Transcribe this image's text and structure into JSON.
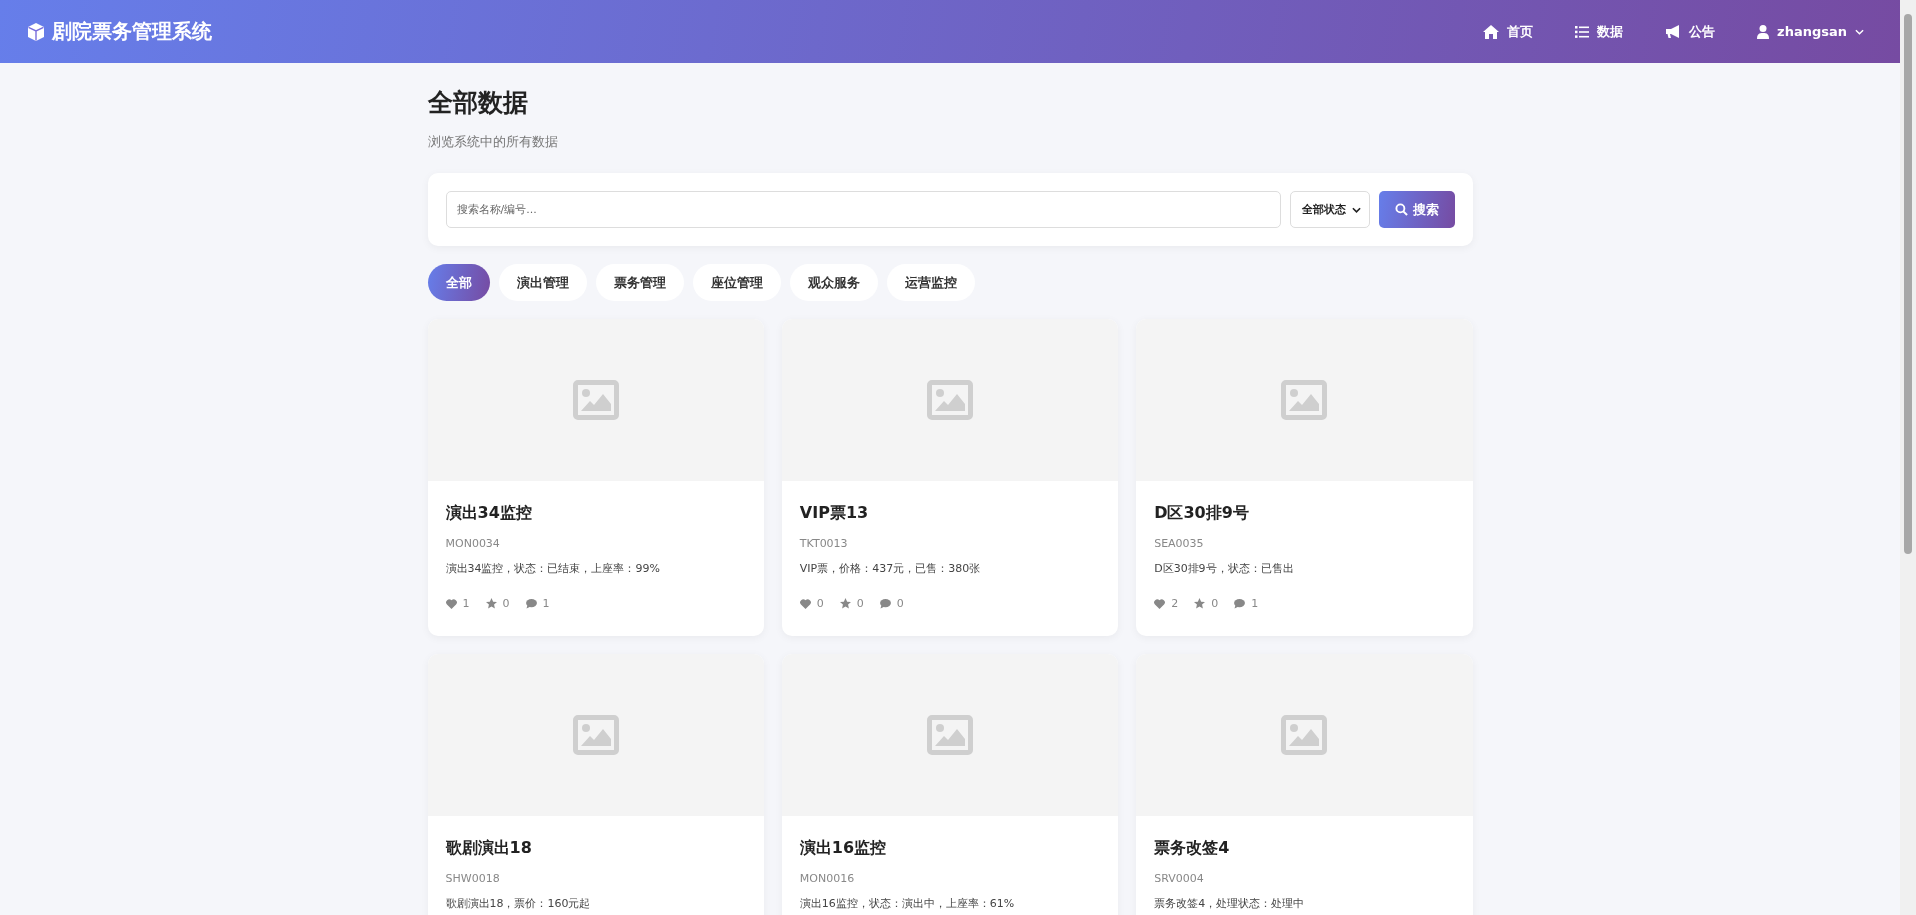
{
  "brand": {
    "title": "剧院票务管理系统"
  },
  "nav": [
    {
      "kind": "home",
      "label": "首页"
    },
    {
      "kind": "list",
      "label": "数据"
    },
    {
      "kind": "megaphone",
      "label": "公告"
    }
  ],
  "user": {
    "name": "zhangsan"
  },
  "page": {
    "title": "全部数据",
    "subtitle": "浏览系统中的所有数据"
  },
  "search": {
    "placeholder": "搜索名称/编号...",
    "status_select": "全部状态",
    "button": "搜索"
  },
  "categories": [
    {
      "label": "全部",
      "selected": true
    },
    {
      "label": "演出管理",
      "selected": false
    },
    {
      "label": "票务管理",
      "selected": false
    },
    {
      "label": "座位管理",
      "selected": false
    },
    {
      "label": "观众服务",
      "selected": false
    },
    {
      "label": "运营监控",
      "selected": false
    }
  ],
  "cards": [
    {
      "title": "演出34监控",
      "code": "MON0034",
      "description": "演出34监控，状态：已结束，上座率：99%",
      "likes": "1",
      "stars": "0",
      "comments": "1"
    },
    {
      "title": "VIP票13",
      "code": "TKT0013",
      "description": "VIP票，价格：437元，已售：380张",
      "likes": "0",
      "stars": "0",
      "comments": "0"
    },
    {
      "title": "D区30排9号",
      "code": "SEA0035",
      "description": "D区30排9号，状态：已售出",
      "likes": "2",
      "stars": "0",
      "comments": "1"
    },
    {
      "title": "歌剧演出18",
      "code": "SHW0018",
      "description": "歌剧演出18，票价：160元起"
    },
    {
      "title": "演出16监控",
      "code": "MON0016",
      "description": "演出16监控，状态：演出中，上座率：61%"
    },
    {
      "title": "票务改签4",
      "code": "SRV0004",
      "description": "票务改签4，处理状态：处理中"
    }
  ]
}
